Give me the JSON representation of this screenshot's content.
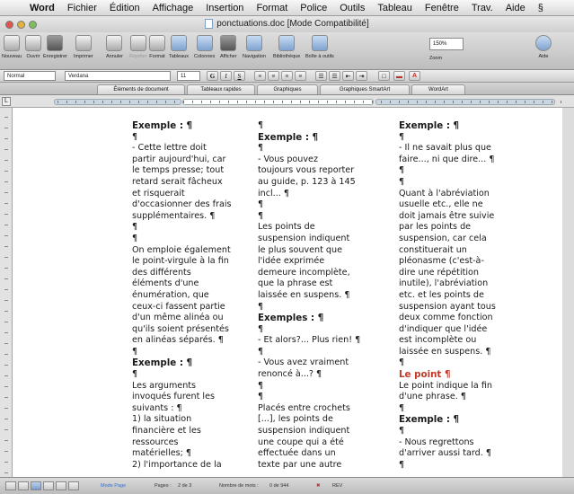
{
  "menubar": {
    "app": "Word",
    "items": [
      "Fichier",
      "Édition",
      "Affichage",
      "Insertion",
      "Format",
      "Police",
      "Outils",
      "Tableau",
      "Fenêtre",
      "Trav.",
      "Aide"
    ]
  },
  "window": {
    "title": "ponctuations.doc [Mode Compatibilité]"
  },
  "toolbar": {
    "buttons": [
      "Nouveau",
      "Ouvrir",
      "Enregistrer",
      "Imprimer",
      "Annuler",
      "Répéter",
      "Format",
      "Tableaux",
      "Colonnes",
      "Afficher",
      "Navigation",
      "Bibliothèque",
      "Boîte à outils",
      "Zoom",
      "Aide"
    ],
    "zoom_value": "150%"
  },
  "format": {
    "style": "Normal",
    "font": "Verdana",
    "size": "11",
    "bold": "G",
    "italic": "I",
    "underline": "S"
  },
  "gallery": {
    "tabs": [
      "Éléments de document",
      "Tableaux rapides",
      "Graphiques",
      "Graphiques SmartArt",
      "WordArt"
    ]
  },
  "ruler": {
    "corner": "L"
  },
  "document": {
    "col1": [
      {
        "type": "h",
        "text": "Exemple : ¶"
      },
      {
        "type": "p",
        "text": "¶"
      },
      {
        "type": "p",
        "text": "- Cette lettre doit\npartir aujourd'hui, car\nle temps presse; tout\nretard serait fâcheux\net risquerait\nd'occasionner des frais\nsupplémentaires. ¶"
      },
      {
        "type": "p",
        "text": "¶"
      },
      {
        "type": "p",
        "text": "¶"
      },
      {
        "type": "p",
        "text": "On emploie également\nle point-virgule à la fin\ndes différents\néléments d'une\nénumération, que\nceux-ci fassent partie\nd'un même alinéa ou\nqu'ils soient présentés\nen alinéas séparés. ¶"
      },
      {
        "type": "p",
        "text": "¶"
      },
      {
        "type": "h",
        "text": "Exemple : ¶"
      },
      {
        "type": "p",
        "text": "¶"
      },
      {
        "type": "p",
        "text": "Les arguments\ninvoqués furent les\nsuivants : ¶\n1) la situation\nfinancière et les\nressources\nmatérielles; ¶\n2) l'importance de la"
      }
    ],
    "col2": [
      {
        "type": "p",
        "text": "¶"
      },
      {
        "type": "h",
        "text": "Exemple : ¶"
      },
      {
        "type": "p",
        "text": "¶"
      },
      {
        "type": "p",
        "text": "- Vous pouvez\ntoujours vous reporter\nau guide, p. 123 à 145\nincl... ¶"
      },
      {
        "type": "p",
        "text": "¶"
      },
      {
        "type": "p",
        "text": "¶"
      },
      {
        "type": "p",
        "text": "Les points de\nsuspension indiquent\nle plus souvent que\nl'idée exprimée\ndemeure incomplète,\nque la phrase est\nlaissée en suspens. ¶"
      },
      {
        "type": "p",
        "text": "¶"
      },
      {
        "type": "h",
        "text": "Exemples : ¶"
      },
      {
        "type": "p",
        "text": "¶"
      },
      {
        "type": "p",
        "text": "- Et alors?... Plus rien! ¶"
      },
      {
        "type": "p",
        "text": "¶"
      },
      {
        "type": "p",
        "text": "- Vous avez vraiment\nrenoncé à...? ¶"
      },
      {
        "type": "p",
        "text": "¶"
      },
      {
        "type": "p",
        "text": "¶"
      },
      {
        "type": "p",
        "text": "Placés entre crochets\n[...], les points de\nsuspension indiquent\nune coupe qui a été\neffectuée dans un\ntexte par une autre"
      }
    ],
    "col3": [
      {
        "type": "h",
        "text": "Exemple : ¶"
      },
      {
        "type": "p",
        "text": "¶"
      },
      {
        "type": "p",
        "text": "- Il ne savait plus que\nfaire..., ni que dire... ¶"
      },
      {
        "type": "p",
        "text": "¶"
      },
      {
        "type": "p",
        "text": "¶"
      },
      {
        "type": "p",
        "text": "Quant à l'abréviation\nusuelle etc., elle ne\ndoit jamais être suivie\npar les points de\nsuspension, car cela\nconstituerait un\npléonasme (c'est-à-\ndire une répétition\ninutile), l'abréviation\netc. et les points de\nsuspension ayant tous\ndeux comme fonction\nd'indiquer que l'idée\nest incomplète ou\nlaissée en suspens. ¶"
      },
      {
        "type": "p",
        "text": "¶"
      },
      {
        "type": "hr",
        "text": "Le point ¶"
      },
      {
        "type": "p",
        "text": "Le point indique la fin\nd'une phrase. ¶"
      },
      {
        "type": "p",
        "text": "¶"
      },
      {
        "type": "h",
        "text": "Exemple : ¶"
      },
      {
        "type": "p",
        "text": "¶"
      },
      {
        "type": "p",
        "text": "- Nous regrettons\nd'arriver aussi tard. ¶"
      },
      {
        "type": "p",
        "text": "¶"
      }
    ]
  },
  "status": {
    "mode": "Mode Page",
    "pages_label": "Pages :",
    "pages_value": "2 de 3",
    "words_label": "Nombre de mots :",
    "words_value": "0 de 944",
    "track": "REV"
  }
}
